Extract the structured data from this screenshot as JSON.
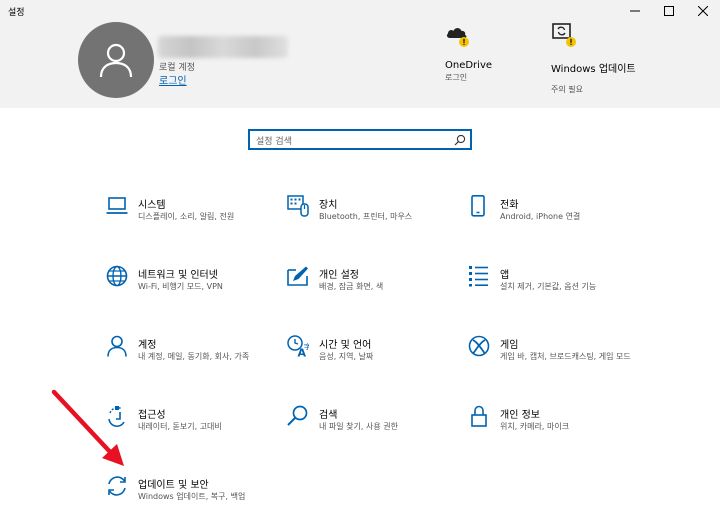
{
  "window": {
    "title": "설정"
  },
  "account": {
    "type_label": "로컬 계정",
    "login_label": "로그인"
  },
  "header_items": [
    {
      "name": "OneDrive",
      "sub": "로그인",
      "icon": "cloud-warning-icon"
    },
    {
      "name": "Windows 업데이트",
      "sub": "주의 필요",
      "icon": "update-warning-icon"
    }
  ],
  "search": {
    "placeholder": "설정 검색"
  },
  "tiles": [
    {
      "name": "시스템",
      "desc": "디스플레이, 소리, 알림, 전원",
      "icon": "laptop-icon"
    },
    {
      "name": "장치",
      "desc": "Bluetooth, 프린터, 마우스",
      "icon": "keyboard-icon"
    },
    {
      "name": "전화",
      "desc": "Android, iPhone 연결",
      "icon": "phone-icon"
    },
    {
      "name": "네트워크 및 인터넷",
      "desc": "Wi-Fi, 비행기 모드, VPN",
      "icon": "globe-icon"
    },
    {
      "name": "개인 설정",
      "desc": "배경, 잠금 화면, 색",
      "icon": "paint-icon"
    },
    {
      "name": "앱",
      "desc": "설치 제거, 기본값, 옵션 기능",
      "icon": "apps-list-icon"
    },
    {
      "name": "계정",
      "desc": "내 계정, 메일, 동기화, 회사, 가족",
      "icon": "person-icon"
    },
    {
      "name": "시간 및 언어",
      "desc": "음성, 지역, 날짜",
      "icon": "time-language-icon"
    },
    {
      "name": "게임",
      "desc": "게임 바, 캡처, 브로드캐스팅, 게임 모드",
      "icon": "xbox-icon"
    },
    {
      "name": "접근성",
      "desc": "내레이터, 돋보기, 고대비",
      "icon": "accessibility-icon"
    },
    {
      "name": "검색",
      "desc": "내 파일 찾기, 사용 권한",
      "icon": "search-icon"
    },
    {
      "name": "개인 정보",
      "desc": "위치, 카메라, 마이크",
      "icon": "lock-icon"
    },
    {
      "name": "업데이트 및 보안",
      "desc": "Windows 업데이트, 복구, 백업",
      "icon": "sync-icon"
    }
  ],
  "colors": {
    "accent": "#0063b1",
    "warning": "#f5c400",
    "annotation_arrow": "#e81123"
  }
}
